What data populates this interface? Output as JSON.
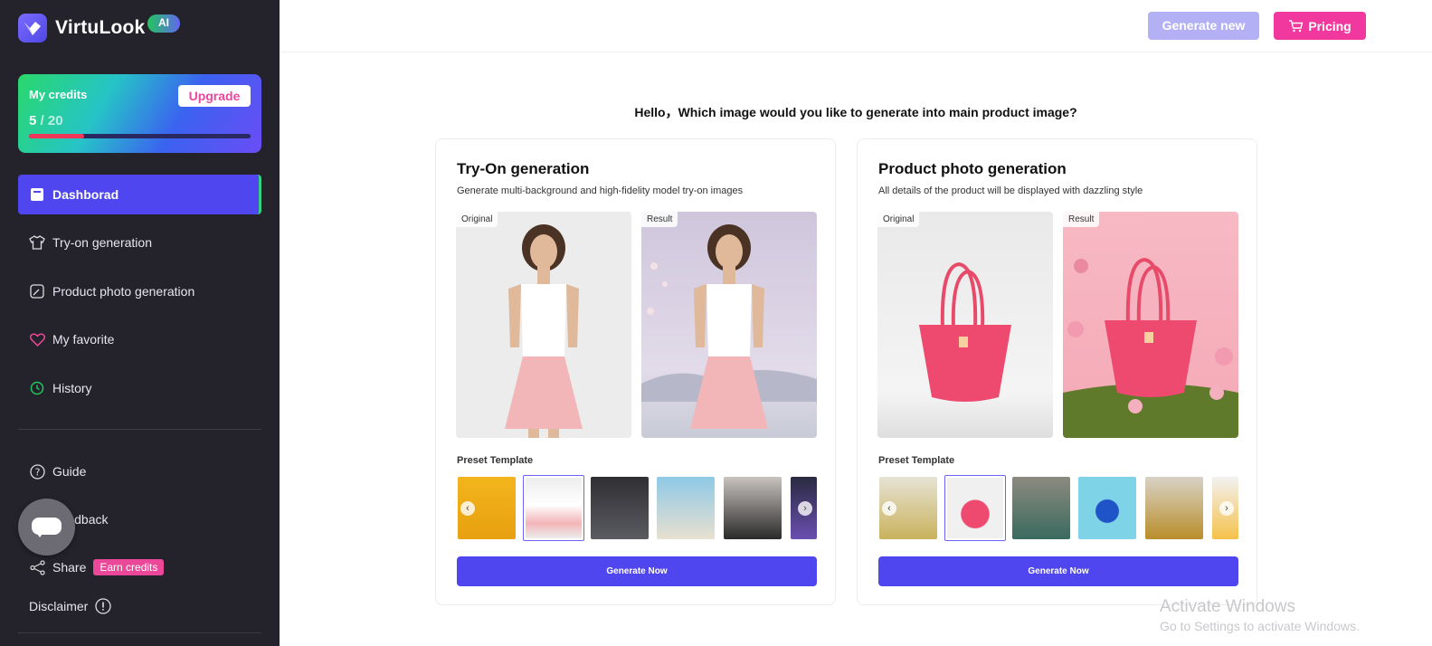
{
  "app": {
    "name": "VirtuLook",
    "badge": "AI"
  },
  "credits": {
    "title": "My credits",
    "used": "5",
    "separator": " / ",
    "total": "20",
    "upgrade_label": "Upgrade",
    "progress_fraction": 0.25
  },
  "nav": {
    "items": [
      {
        "label": "Dashborad",
        "icon": "dashboard-icon",
        "active": true
      },
      {
        "label": "Try-on generation",
        "icon": "shirt-icon"
      },
      {
        "label": "Product photo generation",
        "icon": "image-edit-icon"
      },
      {
        "label": "My favorite",
        "icon": "heart-icon"
      },
      {
        "label": "History",
        "icon": "clock-icon"
      }
    ],
    "secondary": [
      {
        "label": "Guide",
        "icon": "help-circle-icon"
      },
      {
        "label": "Feedback",
        "icon": "feedback-icon"
      },
      {
        "label": "Share",
        "icon": "share-icon",
        "badge": "Earn credits"
      },
      {
        "label": "Disclaimer",
        "icon": "info-icon"
      }
    ]
  },
  "topbar": {
    "generate_new_label": "Generate new",
    "pricing_label": "Pricing"
  },
  "headline": "Hello，Which image would you like to generate into main product image?",
  "cards": [
    {
      "title": "Try-On generation",
      "description": "Generate multi-background and high-fidelity model try-on images",
      "original_tag": "Original",
      "result_tag": "Result",
      "preset_label": "Preset Template",
      "button_label": "Generate Now"
    },
    {
      "title": "Product photo generation",
      "description": "All details of the product will be displayed with dazzling style",
      "original_tag": "Original",
      "result_tag": "Result",
      "preset_label": "Preset Template",
      "button_label": "Generate Now"
    }
  ],
  "colors": {
    "primary": "#4f46ef",
    "pink": "#f0389e",
    "sidebar": "#24232c"
  },
  "watermark": {
    "title": "Activate Windows",
    "subtitle": "Go to Settings to activate Windows."
  }
}
